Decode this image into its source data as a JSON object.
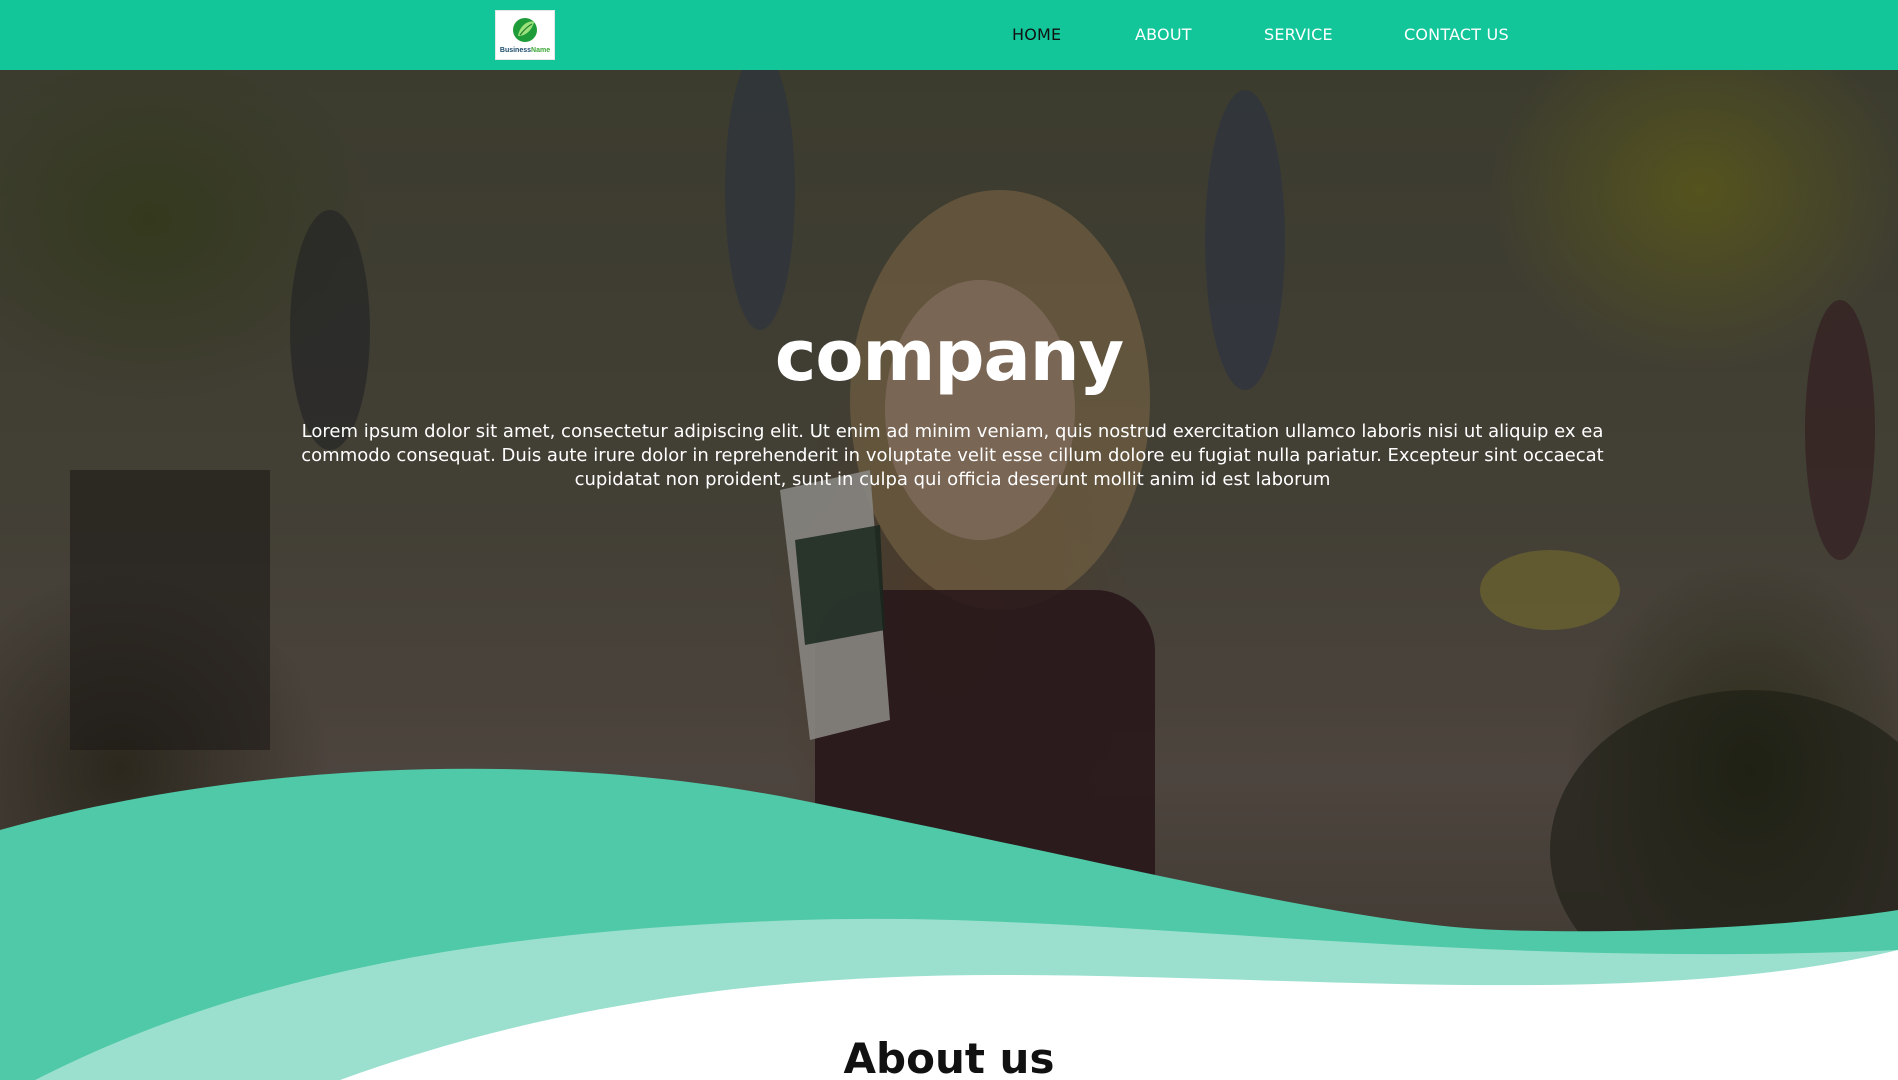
{
  "nav": {
    "logo_alt": "Business Name",
    "logo_text_a": "Business",
    "logo_text_b": "Name",
    "links": [
      {
        "label": "HOME",
        "active": true
      },
      {
        "label": "ABOUT",
        "active": false
      },
      {
        "label": "SERVICE",
        "active": false
      },
      {
        "label": "CONTACT US",
        "active": false
      }
    ]
  },
  "hero": {
    "title": "company",
    "text": "Lorem ipsum dolor sit amet, consectetur adipiscing elit. Ut enim ad minim veniam, quis nostrud exercitation ullamco laboris nisi ut aliquip ex ea commodo consequat. Duis aute irure dolor in reprehenderit in voluptate velit esse cillum dolore eu fugiat nulla pariatur. Excepteur sint occaecat cupidatat non proident, sunt in culpa qui officia deserunt mollit anim id est laborum"
  },
  "about": {
    "title": "About us"
  },
  "colors": {
    "nav_bg": "#13c69a",
    "wave_dark": "#4fc9a7",
    "wave_light": "#9be0cf",
    "page_bg": "#ffffff"
  }
}
